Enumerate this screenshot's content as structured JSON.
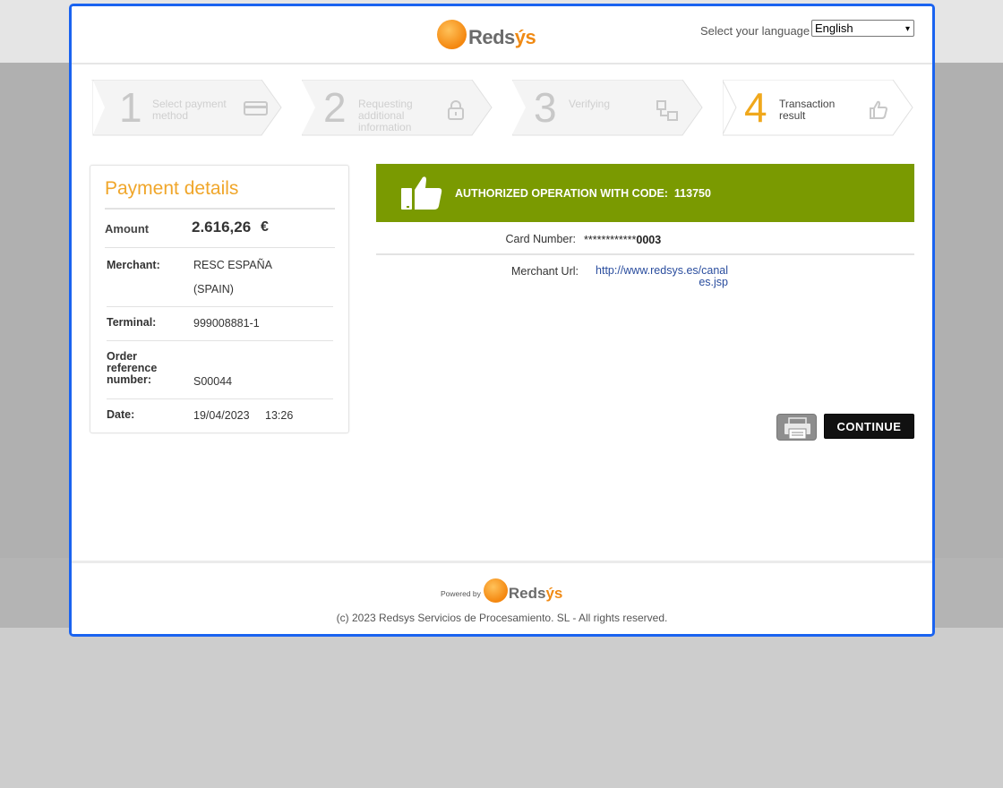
{
  "header": {
    "logo_text_main": "Reds",
    "logo_text_accent": "ýs",
    "language_label": "Select your language",
    "language_selected": "English"
  },
  "steps": [
    {
      "number": "1",
      "label_line1": "Select payment",
      "label_line2": "method",
      "label_line3": "",
      "icon": "credit-card-icon"
    },
    {
      "number": "2",
      "label_line1": "Requesting",
      "label_line2": "additional",
      "label_line3": "information",
      "icon": "lock-icon"
    },
    {
      "number": "3",
      "label_line1": "Verifying",
      "label_line2": "",
      "label_line3": "",
      "icon": "transfer-icon"
    },
    {
      "number": "4",
      "label_line1": "Transaction",
      "label_line2": "result",
      "label_line3": "",
      "icon": "thumbs-up-icon"
    }
  ],
  "details": {
    "title": "Payment details",
    "amount_label": "Amount",
    "amount_value": "2.616,26",
    "currency": "€",
    "merchant_label": "Merchant:",
    "merchant_value_line1": "RESC ESPAÑA",
    "merchant_value_line2": "(SPAIN)",
    "terminal_label": "Terminal:",
    "terminal_value": "999008881-1",
    "order_label_line1": "Order",
    "order_label_line2": "reference",
    "order_label_line3": "number:",
    "order_value": "S00044",
    "date_label": "Date:",
    "date_value": "19/04/2023",
    "time_value": "13:26"
  },
  "result": {
    "auth_text": "AUTHORIZED OPERATION WITH CODE:",
    "auth_code": "113750",
    "card_label": "Card Number:",
    "card_masked": "************",
    "card_last": "0003",
    "merchant_url_label": "Merchant Url:",
    "merchant_url_line1": "http://www.redsys.es/canal",
    "merchant_url_line2": "es.jsp",
    "continue_label": "CONTINUE"
  },
  "footer": {
    "powered_by": "Powered by",
    "copyright": "(c) 2023 Redsys Servicios de Procesamiento. SL - All rights reserved."
  },
  "colors": {
    "accent_orange": "#f0a62a",
    "auth_green": "#7a9a01",
    "window_border": "#1a63f0"
  }
}
